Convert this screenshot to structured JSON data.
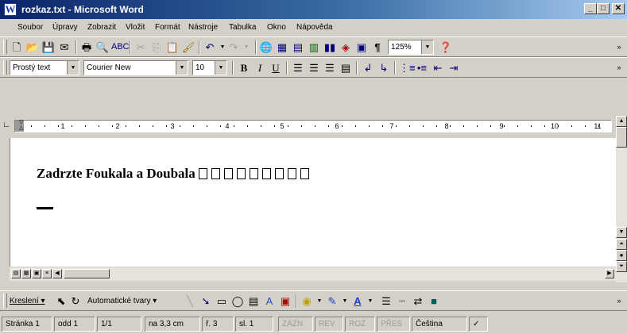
{
  "window": {
    "title": "rozkaz.txt - Microsoft Word",
    "icon": "W",
    "buttons": {
      "minimize": "_",
      "maximize": "□",
      "close": "✕"
    }
  },
  "menu": {
    "items": [
      "Soubor",
      "Úpravy",
      "Zobrazit",
      "Vložit",
      "Formát",
      "Nástroje",
      "Tabulka",
      "Okno",
      "Nápověda"
    ]
  },
  "toolbar": {
    "zoom": "125%",
    "zoom_arrow": "▼",
    "show_hide": "¶",
    "icons": [
      "new-icon",
      "open-icon",
      "save-icon",
      "email-icon",
      "print-icon",
      "print-preview-icon",
      "spelling-icon",
      "cut-icon",
      "copy-icon",
      "paste-icon",
      "format-painter-icon",
      "undo-icon",
      "redo-icon",
      "hyperlink-icon",
      "tables-icon",
      "insert-table-icon",
      "insert-excel-icon",
      "columns-icon",
      "drawing-icon",
      "document-map-icon",
      "help-icon"
    ]
  },
  "formatting": {
    "style": "Prostý text",
    "font": "Courier New",
    "size": "10",
    "bold": "B",
    "italic": "I",
    "underline": "U"
  },
  "ruler": {
    "numbers": [
      "1",
      "2",
      "3",
      "4",
      "5",
      "6",
      "7",
      "8",
      "9",
      "10",
      "11"
    ]
  },
  "document": {
    "heading": "Zadrzte Foukala a Doubala",
    "box_count": 9
  },
  "drawing_toolbar": {
    "draw_label": "Kreslení ▾",
    "autoshapes_label": "Automatické tvary ▾"
  },
  "status": {
    "page": "Stránka  1",
    "section": "odd  1",
    "page_of": "1/1",
    "position": "na  3,3 cm",
    "line": "ř.  3",
    "column": "sl.  1",
    "rec": "ZÁZN",
    "trk": "REV",
    "ext": "ROZ",
    "ovr": "PŘES",
    "language": "Čeština"
  }
}
